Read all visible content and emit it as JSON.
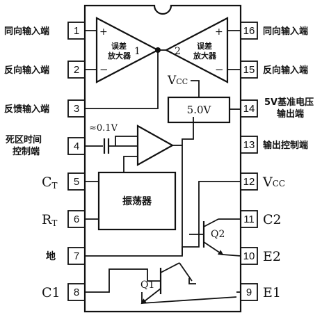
{
  "pins": [
    {
      "num": "1",
      "label": "同向输入端",
      "side": "left"
    },
    {
      "num": "2",
      "label": "反向输入端",
      "side": "left"
    },
    {
      "num": "3",
      "label": "反馈输入端",
      "side": "left"
    },
    {
      "num": "4",
      "label_line1": "死区时间",
      "label_line2": "控制端",
      "side": "left"
    },
    {
      "num": "5",
      "label_main": "C",
      "label_sub": "T",
      "side": "left"
    },
    {
      "num": "6",
      "label_main": "R",
      "label_sub": "T",
      "side": "left"
    },
    {
      "num": "7",
      "label": "地",
      "side": "left"
    },
    {
      "num": "8",
      "label": "C1",
      "side": "left"
    },
    {
      "num": "16",
      "label": "同向输入端",
      "side": "right"
    },
    {
      "num": "15",
      "label": "反向输入端",
      "side": "right"
    },
    {
      "num": "14",
      "label_line1": "5V基准电压",
      "label_line2": "输出端",
      "side": "right"
    },
    {
      "num": "13",
      "label": "输出控制端",
      "side": "right"
    },
    {
      "num": "12",
      "label_main": "V",
      "label_sub": "CC",
      "side": "right"
    },
    {
      "num": "11",
      "label": "C2",
      "side": "right"
    },
    {
      "num": "10",
      "label": "E2",
      "side": "right"
    },
    {
      "num": "9",
      "label": "E1",
      "side": "right"
    }
  ],
  "amp1": {
    "name_line1": "误差",
    "name_line2": "放大器",
    "number": "1",
    "plus": "+",
    "minus": "−"
  },
  "amp2": {
    "name_line1": "误差",
    "name_line2": "放大器",
    "number": "2",
    "plus": "+",
    "minus": "−"
  },
  "vcc_label": {
    "main": "V",
    "sub": "CC"
  },
  "ref_block": {
    "label": "5.0V"
  },
  "deadtime": {
    "label": "≈0.1V"
  },
  "oscillator": {
    "label": "振荡器"
  },
  "q1": {
    "label": "Q1"
  },
  "q2": {
    "label": "Q2"
  }
}
